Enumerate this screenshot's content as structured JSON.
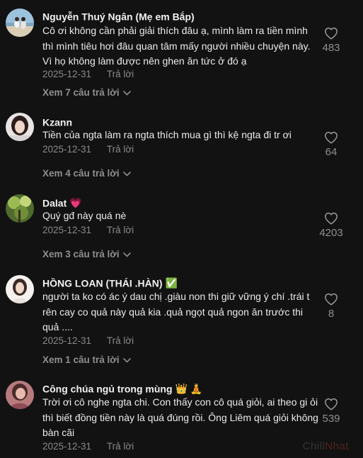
{
  "comments": [
    {
      "username": "Nguyễn Thuý Ngân (Mẹ em Bắp)",
      "text": "Cô ơi không cần phải giải thích đâu ạ, mình làm ra tiền mình thì mình tiêu hơi đâu quan tâm mấy người nhiều chuyện này. Vì họ không làm được nên ghen ăn tức ở đó ạ",
      "date": "2025-12-31",
      "reply_label": "Trả lời",
      "likes": "483",
      "view_replies": "Xem 7 câu trả lời"
    },
    {
      "username": "Kzann",
      "text": "Tiền của ngta làm ra ngta thích mua gì thì kệ ngta đi tr ơi",
      "date": "2025-12-31",
      "reply_label": "Trả lời",
      "likes": "64",
      "view_replies": "Xem 4 câu trả lời"
    },
    {
      "username": "Dalat",
      "badge": "💗",
      "text": "Quý gđ này quá nè",
      "date": "2025-12-31",
      "reply_label": "Trả lời",
      "likes": "4203",
      "view_replies": "Xem 3 câu trả lời"
    },
    {
      "username": "HỒNG LOAN (THÁI .HÀN)",
      "badge": "✅",
      "text": "người ta ko có ác ý dau chị .giàu non thi giữ vững ý chí .trái t rên cay co quả này quả kia .quả ngọt quả ngon ăn trước thi quả ....",
      "date": "2025-12-31",
      "reply_label": "Trả lời",
      "likes": "8",
      "view_replies": "Xem 1 câu trả lời"
    },
    {
      "username": "Công chúa ngủ trong mùng",
      "badge": "👑 🧘",
      "text": "Trời ơi cô nghe ngta chi. Con thấy con cô quá giỏi, ai theo gi ỏi thì biết đồng tiền này là quá đúng rồi. Ông Liêm quá giỏi không bàn cãi",
      "date": "2025-12-31",
      "reply_label": "Trả lời",
      "likes": "539"
    }
  ],
  "watermark": {
    "part1": "Chill",
    "part2": "Nhat"
  },
  "icons": {
    "like": "heart-outline-icon",
    "expand": "chevron-down-icon"
  },
  "colors": {
    "background": "#121212",
    "text": "#ebebeb",
    "muted": "#8a8a8a"
  }
}
